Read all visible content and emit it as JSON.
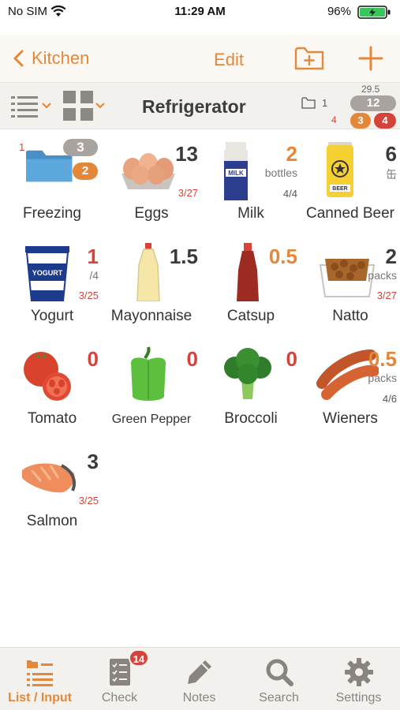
{
  "status": {
    "carrier": "No SIM",
    "time": "11:29 AM",
    "battery": "96%"
  },
  "nav": {
    "back_label": "Kitchen",
    "edit_label": "Edit"
  },
  "toolbar": {
    "title": "Refrigerator",
    "folder_count": "1",
    "total_top": "29.5",
    "total": "12",
    "red_small": "4",
    "badge_orange": "3",
    "badge_red": "4"
  },
  "items": [
    {
      "name": "Freezing",
      "folder": true,
      "badge_gray": "3",
      "badge_orange": "2",
      "red_small": "1"
    },
    {
      "name": "Eggs",
      "qty": "13",
      "date": "3/27"
    },
    {
      "name": "Milk",
      "qty": "2",
      "unit": "bottles",
      "sub": "4/4"
    },
    {
      "name": "Canned Beer",
      "qty": "6",
      "unit": "缶"
    },
    {
      "name": "Yogurt",
      "qty": "1",
      "sub": "/4",
      "date": "3/25"
    },
    {
      "name": "Mayonnaise",
      "qty": "1.5"
    },
    {
      "name": "Catsup",
      "qty": "0.5"
    },
    {
      "name": "Natto",
      "qty": "2",
      "unit": "packs",
      "date": "3/27"
    },
    {
      "name": "Tomato",
      "qty": "0"
    },
    {
      "name": "Green Pepper",
      "qty": "0"
    },
    {
      "name": "Broccoli",
      "qty": "0"
    },
    {
      "name": "Wieners",
      "qty": "0.5",
      "unit": "packs",
      "sub": "4/6"
    },
    {
      "name": "Salmon",
      "qty": "3",
      "date": "3/25"
    }
  ],
  "tabs": [
    {
      "label": "List / Input",
      "icon": "list-input-icon"
    },
    {
      "label": "Check",
      "icon": "checklist-icon",
      "badge": "14"
    },
    {
      "label": "Notes",
      "icon": "pencil-icon"
    },
    {
      "label": "Search",
      "icon": "search-icon"
    },
    {
      "label": "Settings",
      "icon": "gear-icon"
    }
  ],
  "colors": {
    "accent": "#e3883a",
    "alert": "#d5443a",
    "badge_gray": "#a8a39f"
  }
}
